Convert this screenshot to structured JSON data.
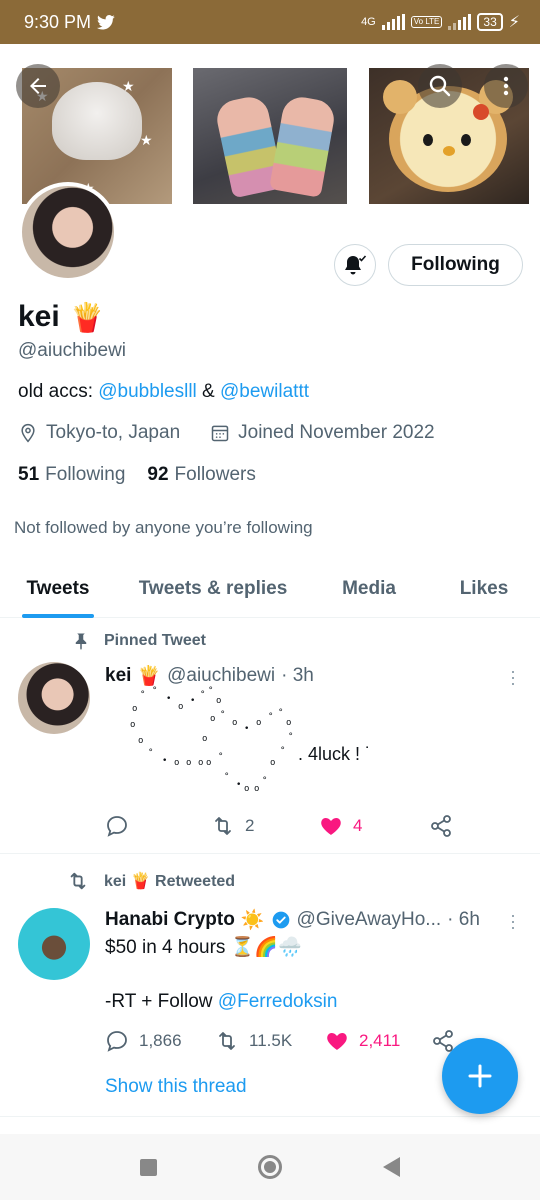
{
  "status_bar": {
    "time": "9:30 PM",
    "network": "4G",
    "lte": "Vo LTE",
    "battery": "33"
  },
  "profile": {
    "name": "kei",
    "name_emoji": "🍟",
    "handle": "@aiuchibewi",
    "bio_prefix": "old accs: ",
    "bio_link1": "@bubbleslll",
    "bio_and": " & ",
    "bio_link2": "@bewilattt",
    "location": "Tokyo-to, Japan",
    "joined": "Joined November 2022",
    "following_count": "51",
    "following_label": "Following",
    "followers_count": "92",
    "followers_label": "Followers",
    "not_followed": "Not followed by anyone you’re following",
    "follow_button": "Following"
  },
  "tabs": [
    {
      "label": "Tweets",
      "active": true
    },
    {
      "label": "Tweets & replies",
      "active": false
    },
    {
      "label": "Media",
      "active": false
    },
    {
      "label": "Likes",
      "active": false
    }
  ],
  "tweets": [
    {
      "context": "Pinned Tweet",
      "name": "kei",
      "name_emoji": "🍟",
      "handle": "@aiuchibewi",
      "time": "· 3h",
      "luck_text": ". 4luck ! ˙",
      "replies": "",
      "retweets": "2",
      "likes": "4"
    },
    {
      "context": "kei 🍟 Retweeted",
      "name": "Hanabi Crypto",
      "name_emoji": "☀️",
      "handle": "@GiveAwayHo...",
      "time": "· 6h",
      "line1": "$50 in 4 hours ⏳🌈🌧️",
      "line2": "-RT + Follow ",
      "line2_link": "@Ferredoksin",
      "replies": "1,866",
      "retweets": "11.5K",
      "likes": "2,411",
      "show_thread": "Show this thread"
    }
  ],
  "colors": {
    "accent": "#1d9bf0",
    "like": "#f91880",
    "status_bar": "#8b6a38"
  }
}
